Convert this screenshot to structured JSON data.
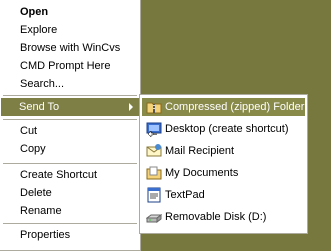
{
  "context_menu": {
    "items": [
      {
        "label": "Open"
      },
      {
        "label": "Explore"
      },
      {
        "label": "Browse with WinCvs"
      },
      {
        "label": "CMD Prompt Here"
      },
      {
        "label": "Search..."
      },
      {
        "label": "Send To"
      },
      {
        "label": "Cut"
      },
      {
        "label": "Copy"
      },
      {
        "label": "Create Shortcut"
      },
      {
        "label": "Delete"
      },
      {
        "label": "Rename"
      },
      {
        "label": "Properties"
      }
    ]
  },
  "send_to_menu": {
    "items": [
      {
        "label": "Compressed (zipped) Folder",
        "icon": "zip-folder-icon"
      },
      {
        "label": "Desktop (create shortcut)",
        "icon": "desktop-shortcut-icon"
      },
      {
        "label": "Mail Recipient",
        "icon": "mail-recipient-icon"
      },
      {
        "label": "My Documents",
        "icon": "my-documents-icon"
      },
      {
        "label": "TextPad",
        "icon": "textpad-icon"
      },
      {
        "label": "Removable Disk (D:)",
        "icon": "removable-disk-icon"
      }
    ]
  },
  "colors": {
    "background": "#76783e",
    "highlight": "#7d7f45",
    "separator": "#acab9e"
  }
}
